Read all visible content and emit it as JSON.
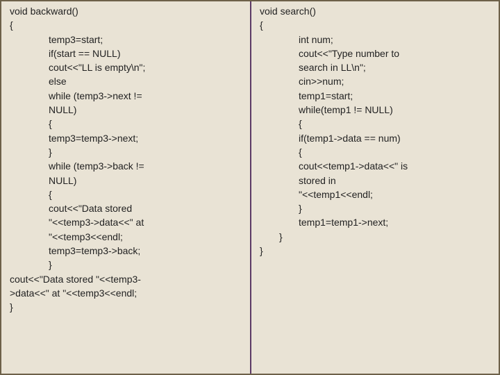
{
  "left": {
    "l1": "void backward()",
    "l2": "{",
    "l3": "temp3=start;",
    "l4": "if(start == NULL)",
    "l5": "cout<<\"LL is empty\\n\";",
    "l6": "else",
    "l7": "while (temp3->next !=\nNULL)",
    "l8": "{",
    "l9": "temp3=temp3->next;",
    "l10": "}",
    "l11": "while (temp3->back !=\nNULL)",
    "l12": "{",
    "l13": "cout<<\"Data stored\n\"<<temp3->data<<\" at\n\"<<temp3<<endl;",
    "l14": "temp3=temp3->back;",
    "l15": "}",
    "l16": "cout<<\"Data stored \"<<temp3-\n>data<<\" at \"<<temp3<<endl;",
    "l17": "}"
  },
  "right": {
    "r1": "void search()",
    "r2": "{",
    "r3": "int num;",
    "r4": "cout<<\"Type number to\nsearch in LL\\n\";",
    "r5": "cin>>num;",
    "r6": "temp1=start;",
    "r7": "while(temp1 != NULL)",
    "r8": "{",
    "r9": "if(temp1->data == num)",
    "r10": "{",
    "r11": "cout<<temp1->data<<\" is\nstored in\n\"<<temp1<<endl;",
    "r12": "}",
    "r13": "temp1=temp1->next;",
    "r14": "}",
    "r15": "}"
  }
}
